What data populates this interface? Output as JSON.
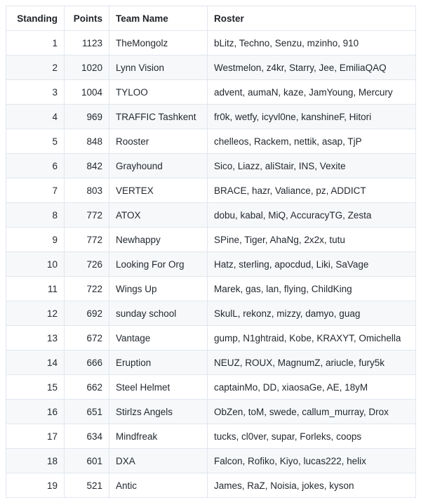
{
  "table": {
    "columns": [
      {
        "key": "standing",
        "label": "Standing",
        "align": "right"
      },
      {
        "key": "points",
        "label": "Points",
        "align": "right"
      },
      {
        "key": "team_name",
        "label": "Team Name",
        "align": "left"
      },
      {
        "key": "roster",
        "label": "Roster",
        "align": "left"
      }
    ],
    "rows": [
      {
        "standing": "1",
        "points": "1123",
        "team_name": "TheMongolz",
        "roster": "bLitz, Techno, Senzu, mzinho, 910"
      },
      {
        "standing": "2",
        "points": "1020",
        "team_name": "Lynn Vision",
        "roster": "Westmelon, z4kr, Starry, Jee, EmiliaQAQ"
      },
      {
        "standing": "3",
        "points": "1004",
        "team_name": "TYLOO",
        "roster": "advent, aumaN, kaze, JamYoung, Mercury"
      },
      {
        "standing": "4",
        "points": "969",
        "team_name": "TRAFFIC Tashkent",
        "roster": "fr0k, wetfy, icyvl0ne, kanshineF, Hitori"
      },
      {
        "standing": "5",
        "points": "848",
        "team_name": "Rooster",
        "roster": "chelleos, Rackem, nettik, asap, TjP"
      },
      {
        "standing": "6",
        "points": "842",
        "team_name": "Grayhound",
        "roster": "Sico, Liazz, aliStair, INS, Vexite"
      },
      {
        "standing": "7",
        "points": "803",
        "team_name": "VERTEX",
        "roster": "BRACE, hazr, Valiance, pz, ADDICT"
      },
      {
        "standing": "8",
        "points": "772",
        "team_name": "ATOX",
        "roster": "dobu, kabal, MiQ, AccuracyTG, Zesta"
      },
      {
        "standing": "9",
        "points": "772",
        "team_name": "Newhappy",
        "roster": "SPine, Tiger, AhaNg, 2x2x, tutu"
      },
      {
        "standing": "10",
        "points": "726",
        "team_name": "Looking For Org",
        "roster": "Hatz, sterling, apocdud, Liki, SaVage"
      },
      {
        "standing": "11",
        "points": "722",
        "team_name": "Wings Up",
        "roster": "Marek, gas, lan, flying, ChildKing"
      },
      {
        "standing": "12",
        "points": "692",
        "team_name": "sunday school",
        "roster": "SkulL, rekonz, mizzy, damyo, guag"
      },
      {
        "standing": "13",
        "points": "672",
        "team_name": "Vantage",
        "roster": "gump, N1ghtraid, Kobe, KRAXYT, Omichella"
      },
      {
        "standing": "14",
        "points": "666",
        "team_name": "Eruption",
        "roster": "NEUZ, ROUX, MagnumZ, ariucle, fury5k"
      },
      {
        "standing": "15",
        "points": "662",
        "team_name": "Steel Helmet",
        "roster": "captainMo, DD, xiaosaGe, AE, 18yM"
      },
      {
        "standing": "16",
        "points": "651",
        "team_name": "Stirlzs Angels",
        "roster": "ObZen, toM, swede, callum_murray, Drox"
      },
      {
        "standing": "17",
        "points": "634",
        "team_name": "Mindfreak",
        "roster": "tucks, cl0ver, supar, Forleks, coops"
      },
      {
        "standing": "18",
        "points": "601",
        "team_name": "DXA",
        "roster": "Falcon, Rofiko, Kiyo, lucas222, helix"
      },
      {
        "standing": "19",
        "points": "521",
        "team_name": "Antic",
        "roster": "James, RaZ, Noisia, jokes, kyson"
      }
    ]
  },
  "colors": {
    "border": "#e2e6ed",
    "row_alt_bg": "#f6f8fa",
    "row_bg": "#ffffff",
    "text": "#24292f"
  }
}
